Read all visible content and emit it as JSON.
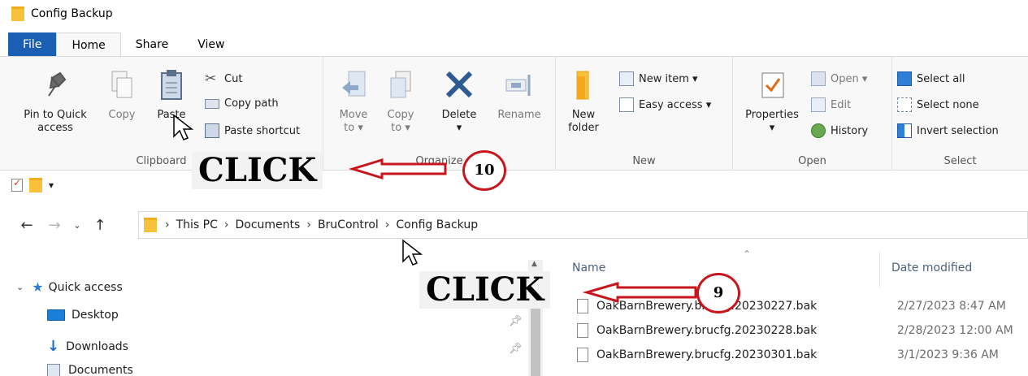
{
  "window": {
    "title": "Config Backup"
  },
  "tabs": [
    "File",
    "Home",
    "Share",
    "View"
  ],
  "ribbon": {
    "clipboard": {
      "label": "Clipboard",
      "pin": "Pin to Quick access",
      "pin_l1": "Pin to Quick",
      "pin_l2": "access",
      "copy": "Copy",
      "paste": "Paste",
      "cut": "Cut",
      "copy_path": "Copy path",
      "paste_shortcut": "Paste shortcut"
    },
    "organize": {
      "label": "Organize",
      "move_l1": "Move",
      "move_l2": "to",
      "copy_l1": "Copy",
      "copy_l2": "to",
      "delete": "Delete",
      "rename": "Rename"
    },
    "new": {
      "label": "New",
      "new_folder_l1": "New",
      "new_folder_l2": "folder",
      "new_item": "New item",
      "easy_access": "Easy access"
    },
    "open": {
      "label": "Open",
      "properties": "Properties",
      "open": "Open",
      "edit": "Edit",
      "history": "History"
    },
    "select": {
      "label": "Select",
      "select_all": "Select all",
      "select_none": "Select none",
      "invert_selection": "Invert selection"
    }
  },
  "breadcrumb": [
    "This PC",
    "Documents",
    "BruControl",
    "Config Backup"
  ],
  "nav_pane": {
    "quick_access": "Quick access",
    "items": [
      "Desktop",
      "Downloads",
      "Documents"
    ]
  },
  "file_list": {
    "columns": {
      "name": "Name",
      "date_modified": "Date modified"
    },
    "rows": [
      {
        "name": "OakBarnBrewery.brucfg.20230227.bak",
        "date": "2/27/2023 8:47 AM"
      },
      {
        "name": "OakBarnBrewery.brucfg.20230228.bak",
        "date": "2/28/2023 12:00 AM"
      },
      {
        "name": "OakBarnBrewery.brucfg.20230301.bak",
        "date": "3/1/2023 9:36 AM"
      }
    ]
  },
  "annotations": {
    "click_label": "CLICK",
    "step_10": "10",
    "step_9": "9"
  },
  "colors": {
    "file_tab": "#1a5fb4",
    "annotation_red": "#c8161d",
    "folder_yellow": "#f8c13a",
    "select_blue": "#2f7fd6"
  }
}
